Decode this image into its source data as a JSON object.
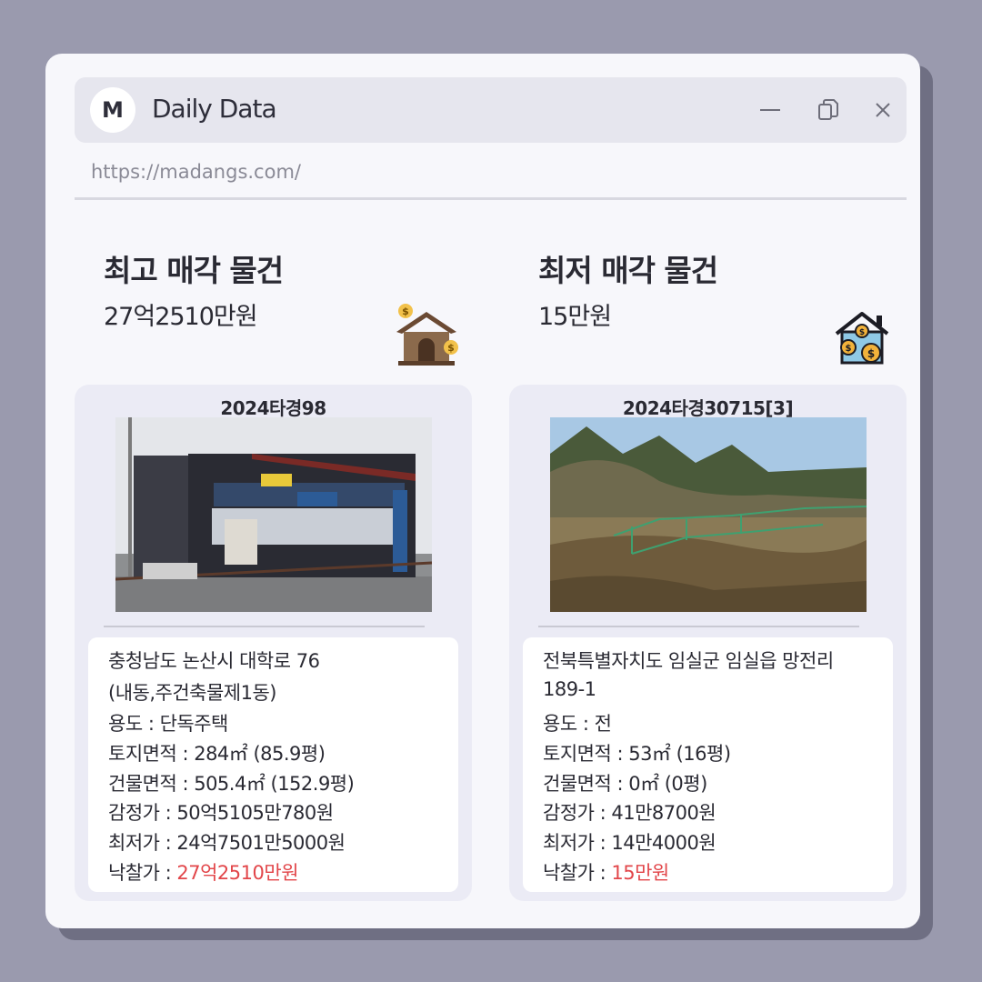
{
  "window": {
    "logo_letter": "M",
    "title": "Daily Data",
    "url": "https://madangs.com/"
  },
  "columns": [
    {
      "heading": "최고 매각 물건",
      "price": "27억2510만원",
      "icon": "house-money-icon",
      "case_no": "2024타경98",
      "photo": "commercial-building-photo",
      "address_line1": "충청남도 논산시 대학로 76",
      "address_line2": "(내동,주건축물제1동)",
      "usage": "용도 : 단독주택",
      "land_area": "토지면적 : 284㎡ (85.9평)",
      "building_area": "건물면적 : 505.4㎡ (152.9평)",
      "appraisal": "감정가 : 50억5105만780원",
      "min_price": "최저가 : 24억7501만5000원",
      "sale_label": "낙찰가 : ",
      "sale_price": "27억2510만원"
    },
    {
      "heading": "최저 매각 물건",
      "price": "15만원",
      "icon": "house-coins-icon",
      "case_no": "2024타경30715[3]",
      "photo": "farmland-photo",
      "address_line1": "전북특별자치도 임실군 임실읍 망전리",
      "address_line2": "189-1",
      "usage": "용도 : 전",
      "land_area": "토지면적 : 53㎡ (16평)",
      "building_area": "건물면적 : 0㎡ (0평)",
      "appraisal": "감정가 :  41만8700원",
      "min_price": "최저가 : 14만4000원",
      "sale_label": "낙찰가 : ",
      "sale_price": "15만원"
    }
  ],
  "colors": {
    "background": "#9a9aae",
    "window": "#f7f7fb",
    "card": "#ebebf5",
    "accent_red": "#e2464a"
  }
}
